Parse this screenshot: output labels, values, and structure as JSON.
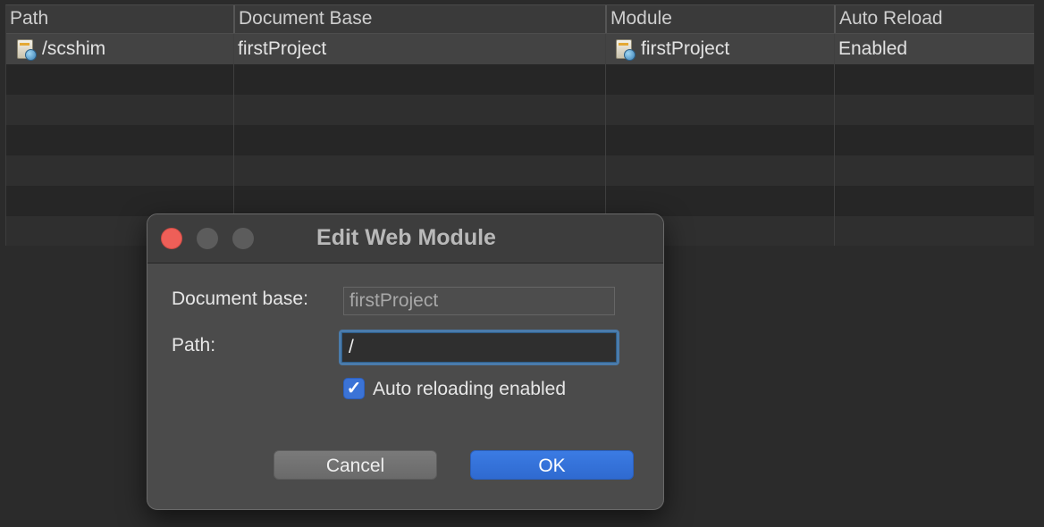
{
  "table": {
    "columns": [
      "Path",
      "Document Base",
      "Module",
      "Auto Reload"
    ],
    "rows": [
      {
        "path": "/scshim",
        "document_base": "firstProject",
        "module": "firstProject",
        "auto_reload": "Enabled"
      }
    ]
  },
  "dialog": {
    "title": "Edit Web Module",
    "document_base_label": "Document base:",
    "document_base_value": "firstProject",
    "path_label": "Path:",
    "path_value": "/",
    "auto_reload_label": "Auto reloading enabled",
    "auto_reload_checked": true,
    "cancel_label": "Cancel",
    "ok_label": "OK"
  },
  "icons": {
    "row_path_icon": "web-module-icon",
    "row_module_icon": "module-icon",
    "checkbox_icon": "checkmark-icon"
  },
  "colors": {
    "accent": "#3b73d6",
    "close_button": "#ee5f58",
    "focus_ring": "#4a7bab"
  }
}
